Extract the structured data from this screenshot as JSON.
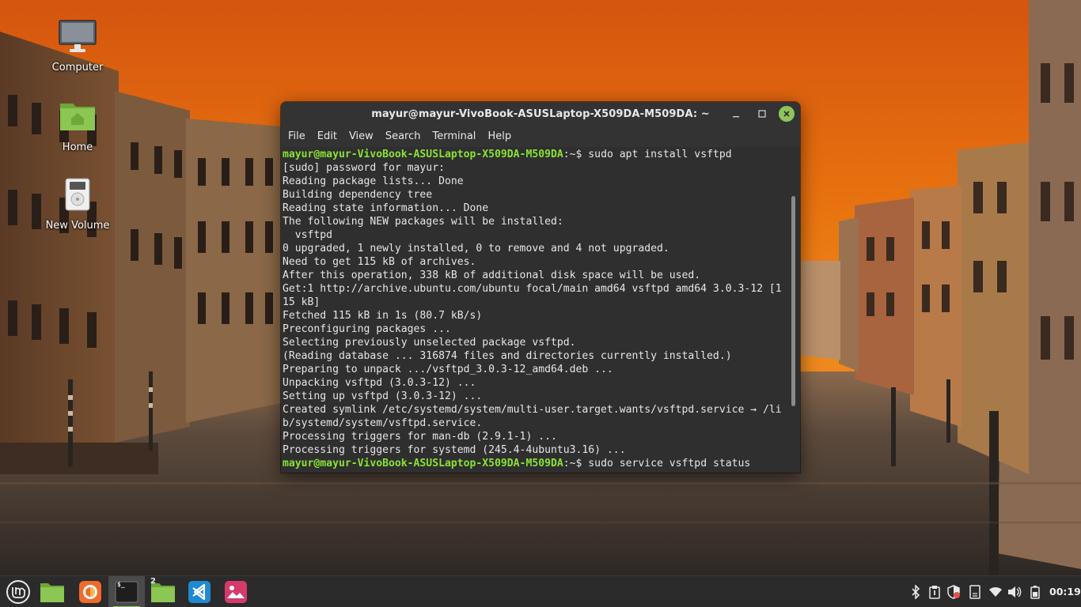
{
  "desktop": {
    "icons": [
      {
        "label": "Computer",
        "icon": "computer-icon"
      },
      {
        "label": "Home",
        "icon": "home-folder-icon"
      },
      {
        "label": "New Volume",
        "icon": "drive-icon"
      }
    ]
  },
  "terminal": {
    "title": "mayur@mayur-VivoBook-ASUSLaptop-X509DA-M509DA: ~",
    "menu": [
      "File",
      "Edit",
      "View",
      "Search",
      "Terminal",
      "Help"
    ],
    "prompt_user": "mayur@mayur-VivoBook-ASUSLaptop-X509DA-M509DA",
    "prompt_path": ":~$ ",
    "lines": [
      {
        "type": "prompt",
        "command": "sudo apt install vsftpd"
      },
      {
        "type": "output",
        "text": "[sudo] password for mayur:"
      },
      {
        "type": "output",
        "text": "Reading package lists... Done"
      },
      {
        "type": "output",
        "text": "Building dependency tree"
      },
      {
        "type": "output",
        "text": "Reading state information... Done"
      },
      {
        "type": "output",
        "text": "The following NEW packages will be installed:"
      },
      {
        "type": "output",
        "text": "  vsftpd"
      },
      {
        "type": "output",
        "text": "0 upgraded, 1 newly installed, 0 to remove and 4 not upgraded."
      },
      {
        "type": "output",
        "text": "Need to get 115 kB of archives."
      },
      {
        "type": "output",
        "text": "After this operation, 338 kB of additional disk space will be used."
      },
      {
        "type": "output",
        "text": "Get:1 http://archive.ubuntu.com/ubuntu focal/main amd64 vsftpd amd64 3.0.3-12 [1"
      },
      {
        "type": "output",
        "text": "15 kB]"
      },
      {
        "type": "output",
        "text": "Fetched 115 kB in 1s (80.7 kB/s)"
      },
      {
        "type": "output",
        "text": "Preconfiguring packages ..."
      },
      {
        "type": "output",
        "text": "Selecting previously unselected package vsftpd."
      },
      {
        "type": "output",
        "text": "(Reading database ... 316874 files and directories currently installed.)"
      },
      {
        "type": "output",
        "text": "Preparing to unpack .../vsftpd_3.0.3-12_amd64.deb ..."
      },
      {
        "type": "output",
        "text": "Unpacking vsftpd (3.0.3-12) ..."
      },
      {
        "type": "output",
        "text": "Setting up vsftpd (3.0.3-12) ..."
      },
      {
        "type": "output",
        "text": "Created symlink /etc/systemd/system/multi-user.target.wants/vsftpd.service → /li"
      },
      {
        "type": "output",
        "text": "b/systemd/system/vsftpd.service."
      },
      {
        "type": "output",
        "text": "Processing triggers for man-db (2.9.1-1) ..."
      },
      {
        "type": "output",
        "text": "Processing triggers for systemd (245.4-4ubuntu3.16) ..."
      },
      {
        "type": "prompt",
        "command": "sudo service vsftpd status"
      }
    ]
  },
  "taskbar": {
    "apps": [
      {
        "name": "menu",
        "icon": "mint-menu-icon"
      },
      {
        "name": "files",
        "icon": "folder-icon"
      },
      {
        "name": "firefox",
        "icon": "firefox-icon"
      },
      {
        "name": "terminal",
        "icon": "terminal-icon",
        "active": true
      },
      {
        "name": "files-group",
        "icon": "folder-icon",
        "badge": "2"
      },
      {
        "name": "vscode",
        "icon": "vscode-icon"
      },
      {
        "name": "image-viewer",
        "icon": "image-viewer-icon"
      }
    ],
    "terminal_badge": "$_",
    "tray": [
      "bluetooth-icon",
      "clipboard-icon",
      "update-shield-icon",
      "notes-icon",
      "wifi-icon",
      "volume-icon",
      "battery-icon"
    ],
    "clock": "00:19"
  },
  "colors": {
    "prompt": "#8ae234",
    "accent": "#8fc45a",
    "terminal_bg": "#2f2f2f",
    "titlebar_bg": "#333333"
  }
}
